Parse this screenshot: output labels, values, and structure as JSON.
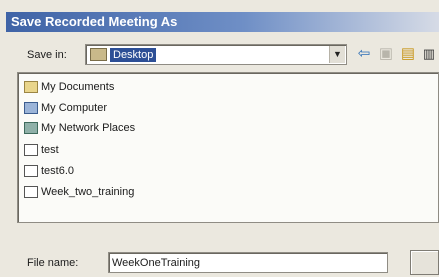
{
  "window": {
    "title": "Save Recorded Meeting As"
  },
  "save_in": {
    "label": "Save in:",
    "value": "Desktop",
    "folder_icon": "desktop-folder-icon"
  },
  "toolbar": {
    "back_icon": "back-arrow-icon",
    "up_icon": "up-one-level-icon",
    "new_folder_icon": "new-folder-icon",
    "views_icon": "views-menu-icon"
  },
  "file_list": [
    {
      "name": "My Documents",
      "icon": "my-documents-folder-icon"
    },
    {
      "name": "My Computer",
      "icon": "my-computer-icon"
    },
    {
      "name": "My Network Places",
      "icon": "network-places-icon"
    },
    {
      "name": "test",
      "icon": "document-icon"
    },
    {
      "name": "test6.0",
      "icon": "document-icon"
    },
    {
      "name": "Week_two_training",
      "icon": "document-icon"
    }
  ],
  "file_name": {
    "label": "File name:",
    "value": "WeekOneTraining"
  }
}
